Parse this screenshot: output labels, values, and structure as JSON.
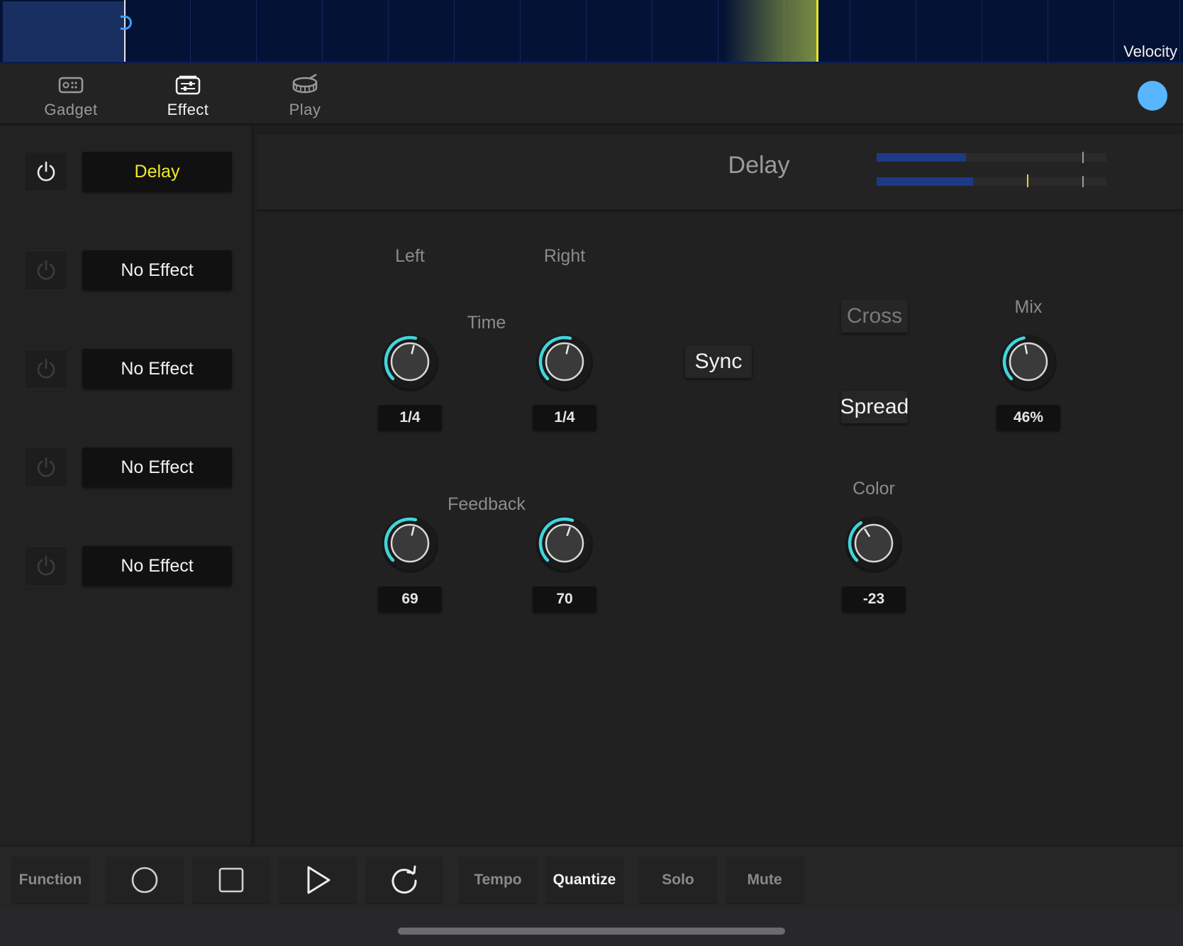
{
  "timeline": {
    "velocity_label": "Velocity",
    "colors": {
      "background": "#041235",
      "playhead": "#e8e22c",
      "loop_handle": "#3aa2ff"
    }
  },
  "tabs": [
    {
      "label": "Gadget",
      "icon": "gadget-icon",
      "active": false
    },
    {
      "label": "Effect",
      "icon": "effect-sliders-icon",
      "active": true
    },
    {
      "label": "Play",
      "icon": "drum-icon",
      "active": false
    }
  ],
  "status_dot_color": "#57b6ff",
  "slots": [
    {
      "name": "Delay",
      "on": true
    },
    {
      "name": "No Effect",
      "on": false
    },
    {
      "name": "No Effect",
      "on": false
    },
    {
      "name": "No Effect",
      "on": false
    },
    {
      "name": "No Effect",
      "on": false
    }
  ],
  "effect": {
    "title": "Delay",
    "meters": {
      "left_level": 0.39,
      "right_level": 0.42
    },
    "labels": {
      "left": "Left",
      "right": "Right",
      "time": "Time",
      "feedback": "Feedback",
      "mix": "Mix",
      "color": "Color"
    },
    "buttons": {
      "sync": "Sync",
      "cross": "Cross",
      "spread": "Spread"
    },
    "knobs": {
      "time_left": {
        "value": "1/4",
        "level": 0.55
      },
      "time_right": {
        "value": "1/4",
        "level": 0.55
      },
      "feedback_left": {
        "value": "69",
        "level": 0.55
      },
      "feedback_right": {
        "value": "70",
        "level": 0.57
      },
      "mix": {
        "value": "46%",
        "level": 0.46
      },
      "color": {
        "value": "-23",
        "level": 0.38
      }
    },
    "accent_color": "#3fd6dc"
  },
  "transport": {
    "function": "Function",
    "record_icon": "record-icon",
    "stop_icon": "stop-icon",
    "play_icon": "play-icon",
    "loop_icon": "loop-icon",
    "tempo": "Tempo",
    "quantize": "Quantize",
    "solo": "Solo",
    "mute": "Mute"
  }
}
